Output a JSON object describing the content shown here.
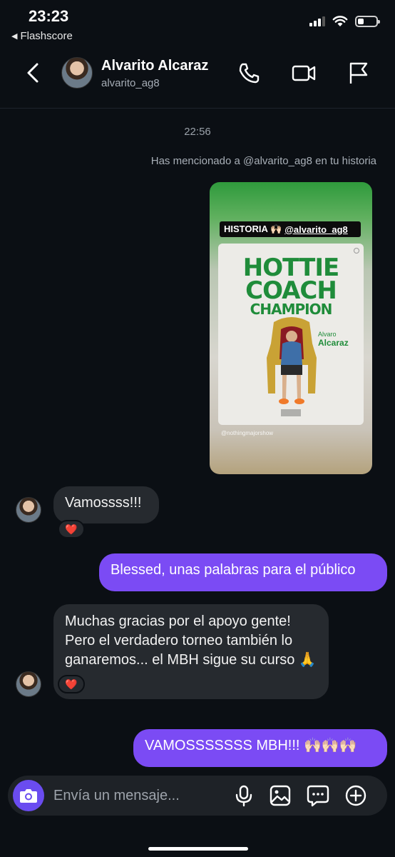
{
  "status": {
    "time": "23:23",
    "back_app": "Flashscore"
  },
  "header": {
    "name": "Alvarito Alcaraz",
    "handle": "alvarito_ag8"
  },
  "thread": {
    "timestamp": "22:56",
    "mention_notice": "Has mencionado a @alvarito_ag8 en tu historia",
    "story": {
      "label_text": "HISTORIA 🙌🏻",
      "label_tag": "@alvarito_ag8",
      "poster_line1": "HOTTIE",
      "poster_line2": "COACH",
      "poster_line3": "CHAMPION",
      "poster_name_first": "Alvaro",
      "poster_name_last": "Alcaraz",
      "credit": "@nothingmajorshow"
    },
    "messages": [
      {
        "from": "them",
        "text": "Vamossss!!!",
        "reaction": "❤️"
      },
      {
        "from": "me",
        "text": "Blessed, unas palabras para el público"
      },
      {
        "from": "them",
        "text": "Muchas gracias por el apoyo gente! Pero el verdadero torneo también lo ganaremos... el MBH sigue su curso 🙏",
        "reaction": "❤️"
      },
      {
        "from": "me",
        "text": "VAMOSSSSSSS MBH!!! 🙌🏻🙌🏻🙌🏻"
      }
    ]
  },
  "composer": {
    "placeholder": "Envía un mensaje..."
  },
  "colors": {
    "accent": "#7b4bf4",
    "bubble_in": "#262a2f",
    "background": "#0b0f14"
  }
}
